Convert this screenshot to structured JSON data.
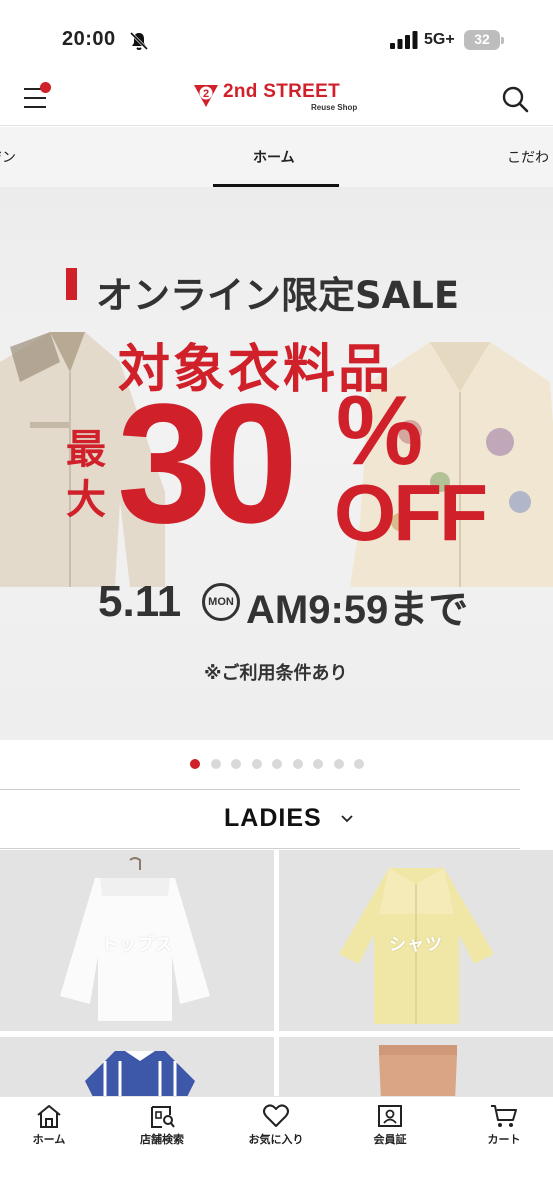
{
  "status_bar": {
    "time": "20:00",
    "network": "5G+",
    "battery": "32"
  },
  "header": {
    "logo_text": "2nd STREET",
    "logo_sub": "Reuse Shop",
    "logo_badge": "2"
  },
  "tabs": [
    {
      "label": "ジン"
    },
    {
      "label": "ホーム",
      "active": true
    },
    {
      "label": "こだわ"
    }
  ],
  "banner": {
    "headline": "オンライン限定SALE",
    "subhead": "対象衣料品",
    "max_label": "最大",
    "discount": "30",
    "percent": "%",
    "off": "OFF",
    "date": "5.11",
    "weekday": "MON",
    "time": "AM9:59まで",
    "note": "※ご利用条件あり"
  },
  "carousel": {
    "total_slides": 9,
    "active_index": 0
  },
  "category": {
    "title": "LADIES"
  },
  "grid": [
    {
      "label": "トップス"
    },
    {
      "label": "シャツ"
    },
    {
      "label": ""
    },
    {
      "label": ""
    }
  ],
  "bottom_nav": [
    {
      "label": "ホーム",
      "icon": "home-icon"
    },
    {
      "label": "店舗検索",
      "icon": "store-search-icon"
    },
    {
      "label": "お気に入り",
      "icon": "heart-icon"
    },
    {
      "label": "会員証",
      "icon": "member-card-icon"
    },
    {
      "label": "カート",
      "icon": "cart-icon"
    }
  ],
  "colors": {
    "brand_red": "#d0202a",
    "text_dark": "#333333",
    "inactive_dot": "#d9d9d9"
  }
}
